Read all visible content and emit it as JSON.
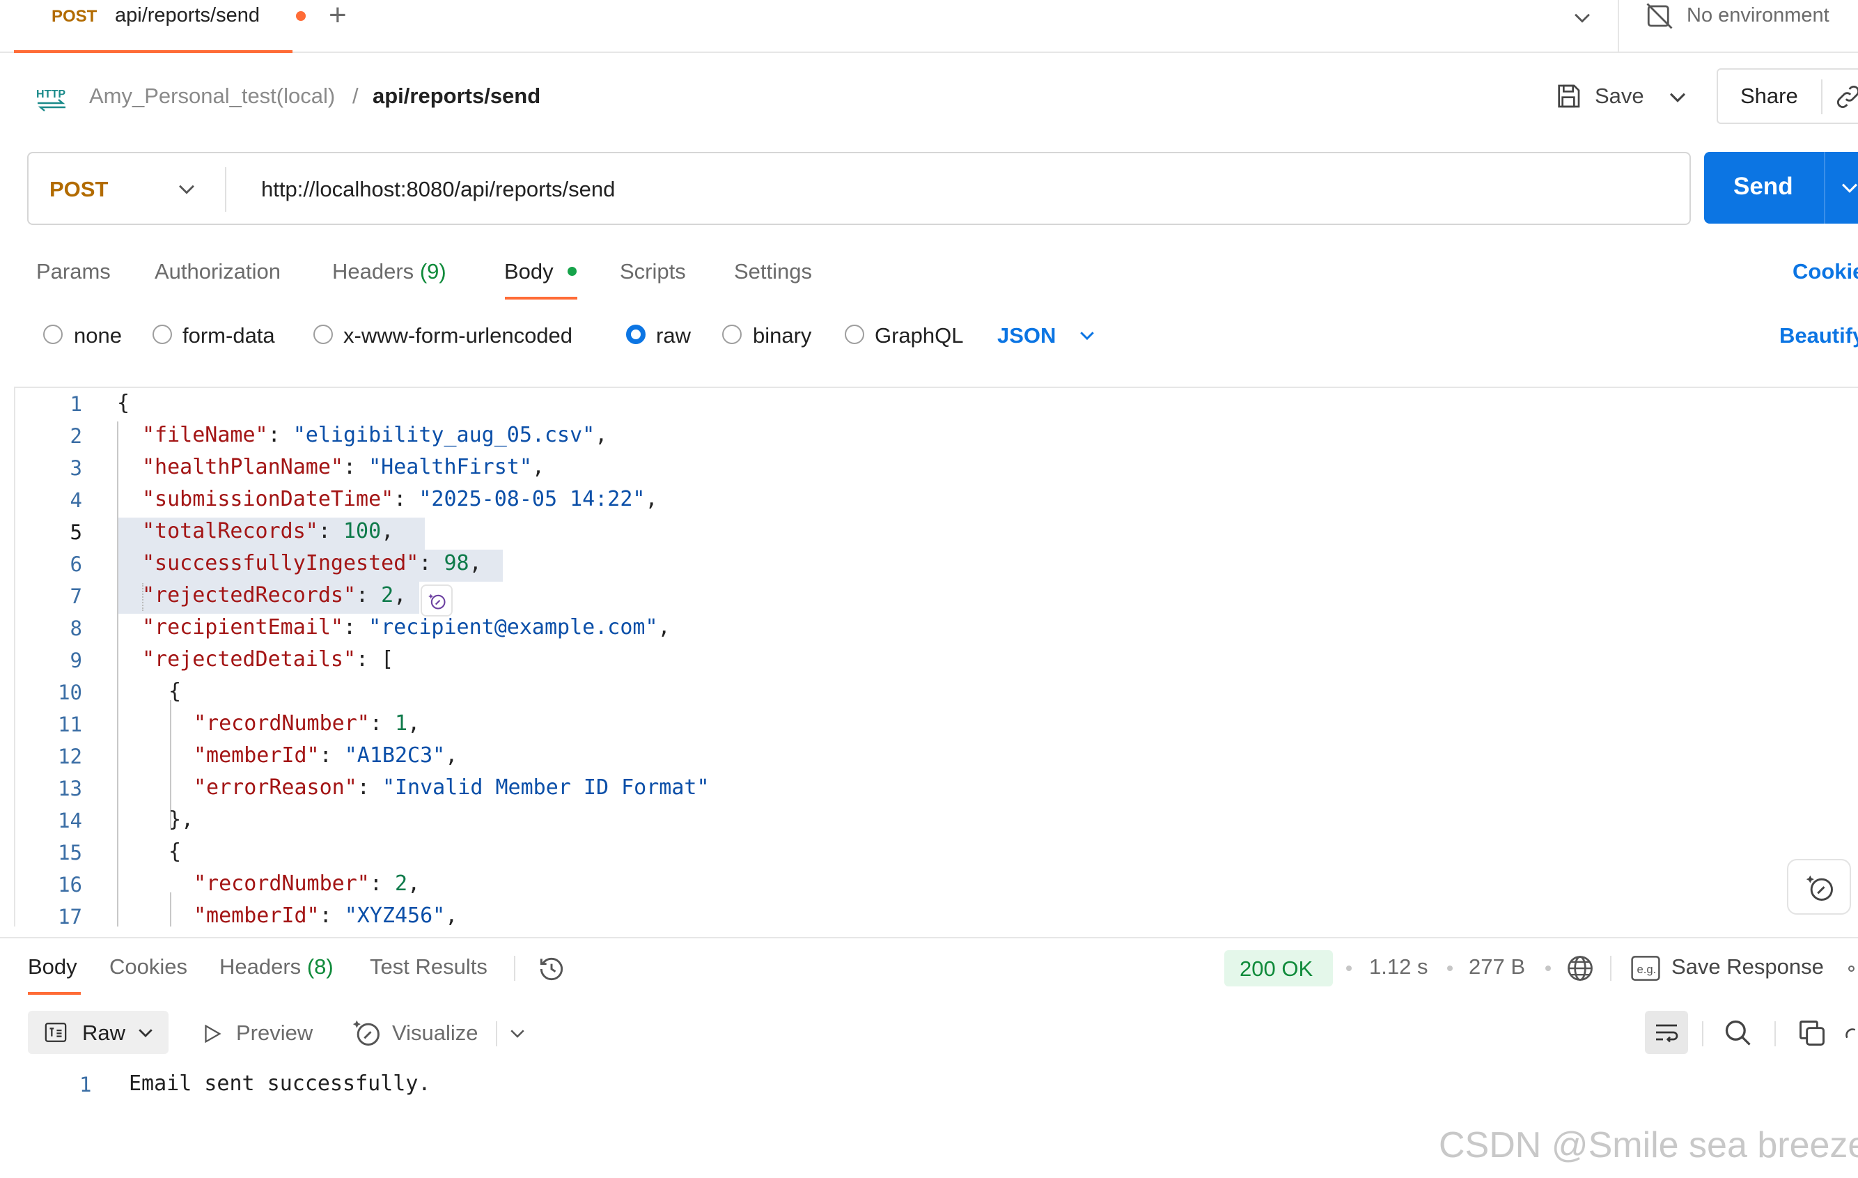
{
  "tab": {
    "method": "POST",
    "title": "api/reports/send"
  },
  "environment": {
    "label": "No environment"
  },
  "breadcrumb": {
    "workspace": "Amy_Personal_test(local)",
    "separator": "/",
    "current": "api/reports/send"
  },
  "header_actions": {
    "save_label": "Save",
    "share_label": "Share"
  },
  "request": {
    "method": "POST",
    "url": "http://localhost:8080/api/reports/send",
    "send_label": "Send"
  },
  "request_tabs": {
    "params": "Params",
    "authorization": "Authorization",
    "headers": "Headers",
    "headers_count": "(9)",
    "body": "Body",
    "scripts": "Scripts",
    "settings": "Settings",
    "cookies": "Cookies"
  },
  "body_types": {
    "none": "none",
    "form_data": "form-data",
    "urlencoded": "x-www-form-urlencoded",
    "raw": "raw",
    "binary": "binary",
    "graphql": "GraphQL",
    "language": "JSON",
    "beautify": "Beautify",
    "selected": "raw"
  },
  "editor": {
    "lines": [
      {
        "n": "1"
      },
      {
        "n": "2",
        "key": "\"fileName\"",
        "val": "\"eligibility_aug_05.csv\""
      },
      {
        "n": "3",
        "key": "\"healthPlanName\"",
        "val": "\"HealthFirst\""
      },
      {
        "n": "4",
        "key": "\"submissionDateTime\"",
        "val": "\"2025-08-05 14:22\""
      },
      {
        "n": "5",
        "key": "\"totalRecords\"",
        "val": "100"
      },
      {
        "n": "6",
        "key": "\"successfullyIngested\"",
        "val": "98"
      },
      {
        "n": "7",
        "key": "\"rejectedRecords\"",
        "val": "2"
      },
      {
        "n": "8",
        "key": "\"recipientEmail\"",
        "val": "\"recipient@example.com\""
      },
      {
        "n": "9",
        "key": "\"rejectedDetails\""
      },
      {
        "n": "10"
      },
      {
        "n": "11",
        "key": "\"recordNumber\"",
        "val": "1"
      },
      {
        "n": "12",
        "key": "\"memberId\"",
        "val": "\"A1B2C3\""
      },
      {
        "n": "13",
        "key": "\"errorReason\"",
        "val": "\"Invalid Member ID Format\""
      },
      {
        "n": "14"
      },
      {
        "n": "15"
      },
      {
        "n": "16",
        "key": "\"recordNumber\"",
        "val": "2"
      },
      {
        "n": "17",
        "key": "\"memberId\"",
        "val": "\"XYZ456\""
      }
    ]
  },
  "response": {
    "tabs": {
      "body": "Body",
      "cookies": "Cookies",
      "headers": "Headers",
      "headers_count": "(8)",
      "test_results": "Test Results"
    },
    "status": "200 OK",
    "time": "1.12 s",
    "size": "277 B",
    "save_response": "Save Response",
    "format_label": "Raw",
    "preview_label": "Preview",
    "visualize_label": "Visualize",
    "line_number": "1",
    "body_text": "Email sent successfully."
  },
  "watermark": "CSDN @Smile sea breeze",
  "colors": {
    "accent_orange": "#ff6c37",
    "send_blue": "#0c75e3",
    "method_post": "#b26b00",
    "status_green": "#0f8a3a"
  }
}
